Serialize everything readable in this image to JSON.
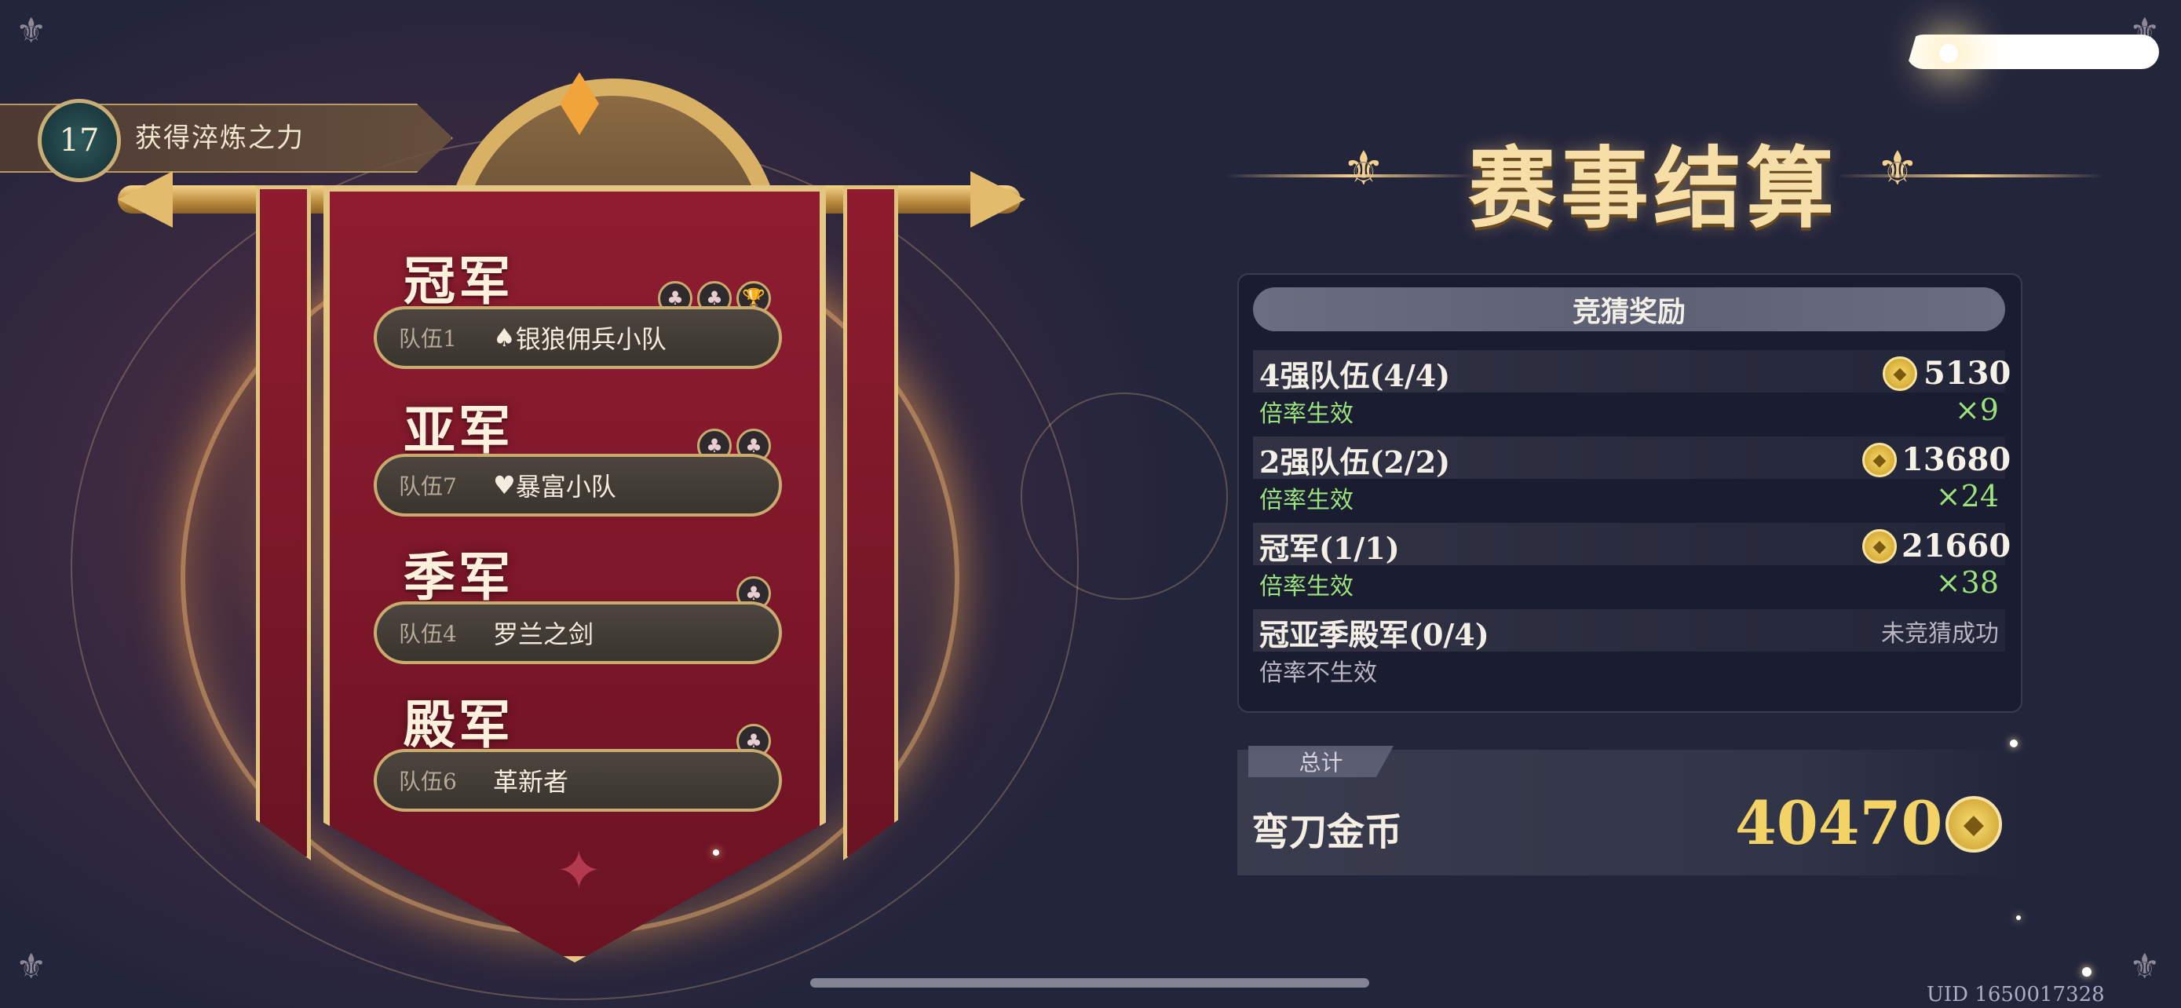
{
  "level": {
    "number": "17",
    "title": "获得淬炼之力"
  },
  "standings": [
    {
      "rank": "冠军",
      "team_no": "队伍1",
      "suit": "♠",
      "team_name": "银狼佣兵小队",
      "chips": [
        "♣",
        "♣",
        "🏆"
      ]
    },
    {
      "rank": "亚军",
      "team_no": "队伍7",
      "suit": "♥",
      "team_name": "暴富小队",
      "chips": [
        "♣",
        "♣"
      ]
    },
    {
      "rank": "季军",
      "team_no": "队伍4",
      "suit": "",
      "team_name": "罗兰之剑",
      "chips": [
        "♣"
      ]
    },
    {
      "rank": "殿军",
      "team_no": "队伍6",
      "suit": "",
      "team_name": "革新者",
      "chips": [
        "♣"
      ]
    }
  ],
  "title": "赛事结算",
  "rewards": {
    "header": "竞猜奖励",
    "rows": [
      {
        "label": "4强队伍(4/4)",
        "value": "5130",
        "status": "倍率生效",
        "multiplier": "×9",
        "active": true
      },
      {
        "label": "2强队伍(2/2)",
        "value": "13680",
        "status": "倍率生效",
        "multiplier": "×24",
        "active": true
      },
      {
        "label": "冠军(1/1)",
        "value": "21660",
        "status": "倍率生效",
        "multiplier": "×38",
        "active": true
      },
      {
        "label": "冠亚季殿军(0/4)",
        "value": "未竞猜成功",
        "status": "倍率不生效",
        "multiplier": "",
        "active": false
      }
    ]
  },
  "total": {
    "tag": "总计",
    "currency": "弯刀金币",
    "amount": "40470"
  },
  "uid": "UID 1650017328",
  "colors": {
    "accent_gold": "#f6dfa6",
    "multiplier_green": "#9be37c",
    "banner_red": "#8f1d31"
  },
  "icons": {
    "coin": "crest-coin-icon",
    "chip": "card-suit-chip-icon",
    "corner": "fleur-corner-icon"
  }
}
